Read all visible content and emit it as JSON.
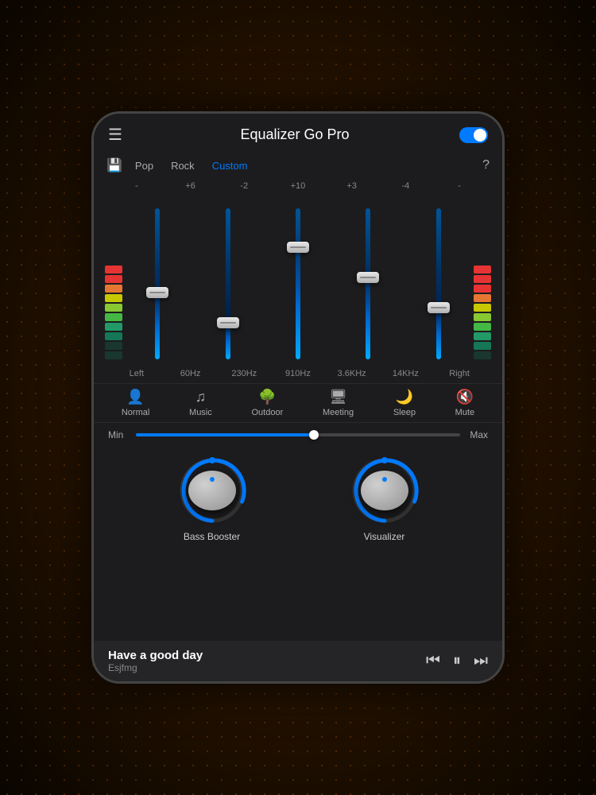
{
  "header": {
    "menu_label": "☰",
    "title": "Equalizer Go Pro",
    "toggle_state": true
  },
  "presets": {
    "save_icon": "💾",
    "items": [
      {
        "label": "Pop",
        "active": false
      },
      {
        "label": "Rock",
        "active": false
      },
      {
        "label": "Custom",
        "active": true
      }
    ],
    "help_icon": "?"
  },
  "eq": {
    "values": [
      {
        "label": "-",
        "id": "left-val"
      },
      {
        "label": "+6",
        "id": "60hz-val"
      },
      {
        "label": "-2",
        "id": "230hz-val"
      },
      {
        "label": "+10",
        "id": "910hz-val"
      },
      {
        "label": "+3",
        "id": "3khz-val"
      },
      {
        "label": "-4",
        "id": "14khz-val"
      },
      {
        "label": "-",
        "id": "right-val"
      }
    ],
    "freq_labels": [
      {
        "label": "Left"
      },
      {
        "label": "60Hz"
      },
      {
        "label": "230Hz"
      },
      {
        "label": "910Hz"
      },
      {
        "label": "3.6KHz"
      },
      {
        "label": "14KHz"
      },
      {
        "label": "Right"
      }
    ],
    "faders": [
      {
        "id": "60hz",
        "handle_pos_pct": 55
      },
      {
        "id": "230hz",
        "handle_pos_pct": 75
      },
      {
        "id": "910hz",
        "handle_pos_pct": 25
      },
      {
        "id": "3khz",
        "handle_pos_pct": 45
      },
      {
        "id": "14khz",
        "handle_pos_pct": 65
      }
    ]
  },
  "modes": [
    {
      "icon": "👤",
      "label": "Normal"
    },
    {
      "icon": "♫",
      "label": "Music"
    },
    {
      "icon": "🌳",
      "label": "Outdoor"
    },
    {
      "icon": "🖥",
      "label": "Meeting"
    },
    {
      "icon": "🌙",
      "label": "Sleep"
    },
    {
      "icon": "🔇",
      "label": "Mute"
    }
  ],
  "volume": {
    "min_label": "Min",
    "max_label": "Max",
    "value_pct": 55
  },
  "knobs": [
    {
      "label": "Bass Booster"
    },
    {
      "label": "Visualizer"
    }
  ],
  "now_playing": {
    "title": "Have a good day",
    "artist": "Esjfmg",
    "prev_icon": "⏮",
    "pause_icon": "⏸",
    "next_icon": "⏭"
  }
}
